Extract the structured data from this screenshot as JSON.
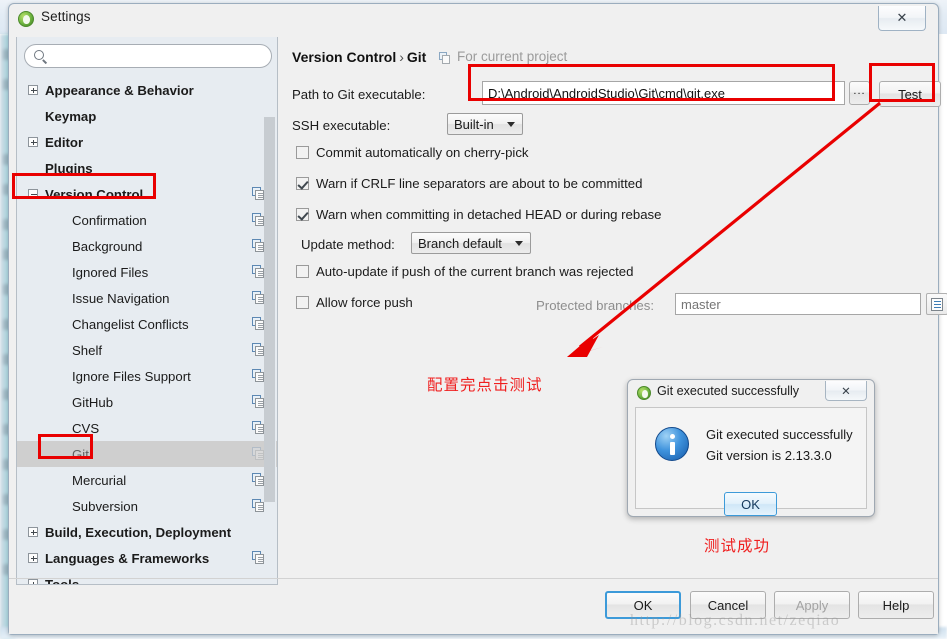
{
  "window": {
    "title": "Settings",
    "close_label": "✕",
    "app_icon": "android-studio-icon"
  },
  "search": {
    "value": "",
    "placeholder": ""
  },
  "sidebar": {
    "items": [
      {
        "label": "Appearance & Behavior",
        "level": 0,
        "toggle": "plus",
        "copy_icon": false,
        "selected": false
      },
      {
        "label": "Keymap",
        "level": 0,
        "toggle": "none",
        "copy_icon": false,
        "selected": false
      },
      {
        "label": "Editor",
        "level": 0,
        "toggle": "plus",
        "copy_icon": false,
        "selected": false
      },
      {
        "label": "Plugins",
        "level": 0,
        "toggle": "none",
        "copy_icon": false,
        "selected": false
      },
      {
        "label": "Version Control",
        "level": 0,
        "toggle": "minus",
        "copy_icon": true,
        "selected": false
      },
      {
        "label": "Confirmation",
        "level": 1,
        "toggle": "none",
        "copy_icon": true,
        "selected": false
      },
      {
        "label": "Background",
        "level": 1,
        "toggle": "none",
        "copy_icon": true,
        "selected": false
      },
      {
        "label": "Ignored Files",
        "level": 1,
        "toggle": "none",
        "copy_icon": true,
        "selected": false
      },
      {
        "label": "Issue Navigation",
        "level": 1,
        "toggle": "none",
        "copy_icon": true,
        "selected": false
      },
      {
        "label": "Changelist Conflicts",
        "level": 1,
        "toggle": "none",
        "copy_icon": true,
        "selected": false
      },
      {
        "label": "Shelf",
        "level": 1,
        "toggle": "none",
        "copy_icon": true,
        "selected": false
      },
      {
        "label": "Ignore Files Support",
        "level": 1,
        "toggle": "none",
        "copy_icon": true,
        "selected": false
      },
      {
        "label": "GitHub",
        "level": 1,
        "toggle": "none",
        "copy_icon": true,
        "selected": false
      },
      {
        "label": "CVS",
        "level": 1,
        "toggle": "none",
        "copy_icon": true,
        "selected": false
      },
      {
        "label": "Git",
        "level": 1,
        "toggle": "none",
        "copy_icon": true,
        "selected": true
      },
      {
        "label": "Mercurial",
        "level": 1,
        "toggle": "none",
        "copy_icon": true,
        "selected": false
      },
      {
        "label": "Subversion",
        "level": 1,
        "toggle": "none",
        "copy_icon": true,
        "selected": false
      },
      {
        "label": "Build, Execution, Deployment",
        "level": 0,
        "toggle": "plus",
        "copy_icon": false,
        "selected": false
      },
      {
        "label": "Languages & Frameworks",
        "level": 0,
        "toggle": "plus",
        "copy_icon": true,
        "selected": false
      },
      {
        "label": "Tools",
        "level": 0,
        "toggle": "plus",
        "copy_icon": false,
        "selected": false
      }
    ]
  },
  "breadcrumb": {
    "root": "Version Control",
    "separator": "›",
    "leaf": "Git",
    "note": "For current project"
  },
  "git_settings": {
    "path_label": "Path to Git executable:",
    "path_value": "D:\\Android\\AndroidStudio\\Git\\cmd\\git.exe",
    "browse_label": "...",
    "test_label": "Test",
    "ssh_label": "SSH executable:",
    "ssh_value": "Built-in",
    "checkboxes": [
      {
        "label": "Commit automatically on cherry-pick",
        "checked": false
      },
      {
        "label": "Warn if CRLF line separators are about to be committed",
        "checked": true
      },
      {
        "label": "Warn when committing in detached HEAD or during rebase",
        "checked": true
      }
    ],
    "update_method_label": "Update method:",
    "update_method_value": "Branch default",
    "auto_update_label": "Auto-update if push of the current branch was rejected",
    "auto_update_checked": false,
    "allow_force_push_label": "Allow force push",
    "allow_force_push_checked": false,
    "protected_branches_label": "Protected branches:",
    "protected_branches_placeholder": "master"
  },
  "footer": {
    "ok": "OK",
    "cancel": "Cancel",
    "apply": "Apply",
    "help": "Help"
  },
  "message_dialog": {
    "title": "Git executed successfully",
    "close_label": "✕",
    "line1": "Git executed successfully",
    "line2": "Git version is 2.13.3.0",
    "ok": "OK"
  },
  "annotations": {
    "note_configure": "配置完点击测试",
    "note_success": "测试成功",
    "highlight_color": "#e90000"
  },
  "watermark": "http://blog.csdn.net/zeqiao"
}
